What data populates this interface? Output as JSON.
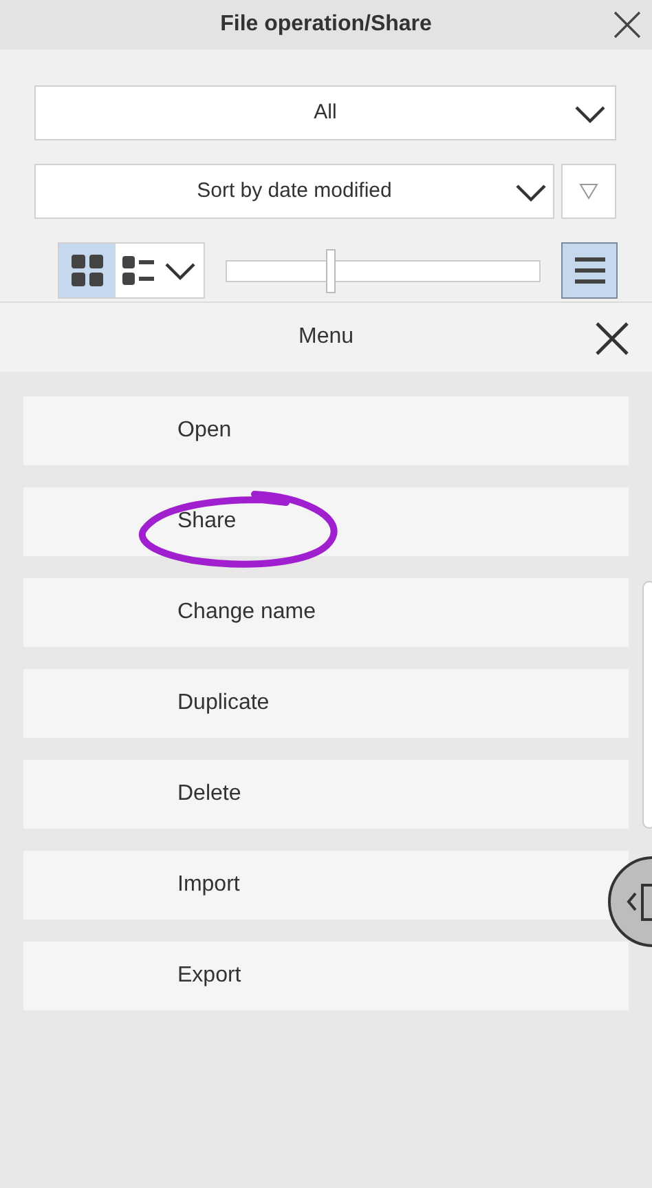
{
  "window": {
    "title": "File operation/Share"
  },
  "filter": {
    "value": "All"
  },
  "sort": {
    "value": "Sort by date modified"
  },
  "view_modes": [
    {
      "kind": "grid",
      "selected": true
    },
    {
      "kind": "list",
      "selected": false
    }
  ],
  "size_slider": {
    "level": 0.33
  },
  "menu_button": {
    "selected": true
  },
  "menu": {
    "title": "Menu",
    "items": [
      {
        "label": "Open"
      },
      {
        "label": "Share"
      },
      {
        "label": "Change name"
      },
      {
        "label": "Duplicate"
      },
      {
        "label": "Delete"
      },
      {
        "label": "Import"
      },
      {
        "label": "Export"
      }
    ]
  }
}
